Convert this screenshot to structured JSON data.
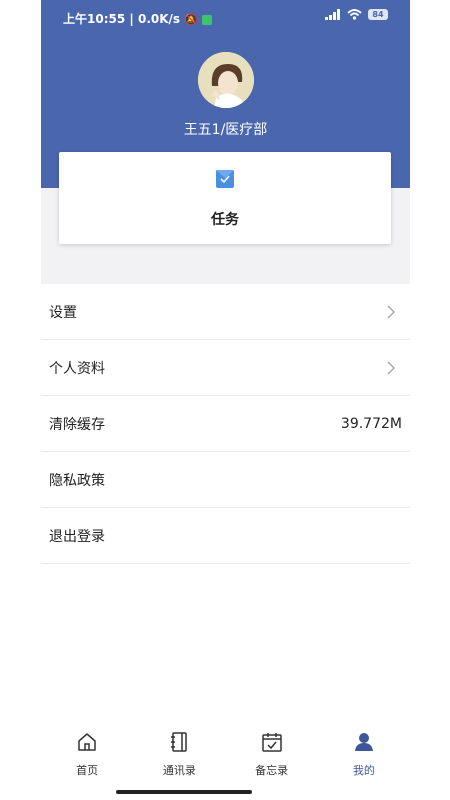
{
  "status_bar": {
    "time": "上午10:55",
    "network_speed": "0.0K/s",
    "battery": "84"
  },
  "profile": {
    "user_name": "王五1/医疗部"
  },
  "task_card": {
    "label": "任务"
  },
  "menu": {
    "items": [
      {
        "label": "设置",
        "value": "",
        "arrow": true
      },
      {
        "label": "个人资料",
        "value": "",
        "arrow": true
      },
      {
        "label": "清除缓存",
        "value": "39.772M",
        "arrow": false
      },
      {
        "label": "隐私政策",
        "value": "",
        "arrow": false
      },
      {
        "label": "退出登录",
        "value": "",
        "arrow": false
      }
    ]
  },
  "tabbar": {
    "tabs": [
      {
        "label": "首页",
        "icon": "home-icon",
        "active": false
      },
      {
        "label": "通讯录",
        "icon": "contacts-book-icon",
        "active": false
      },
      {
        "label": "备忘录",
        "icon": "calendar-check-icon",
        "active": false
      },
      {
        "label": "我的",
        "icon": "person-icon",
        "active": true
      }
    ]
  },
  "colors": {
    "header": "#4a67ae",
    "active_tab": "#3d5798",
    "task_icon": "#4a90e2"
  }
}
